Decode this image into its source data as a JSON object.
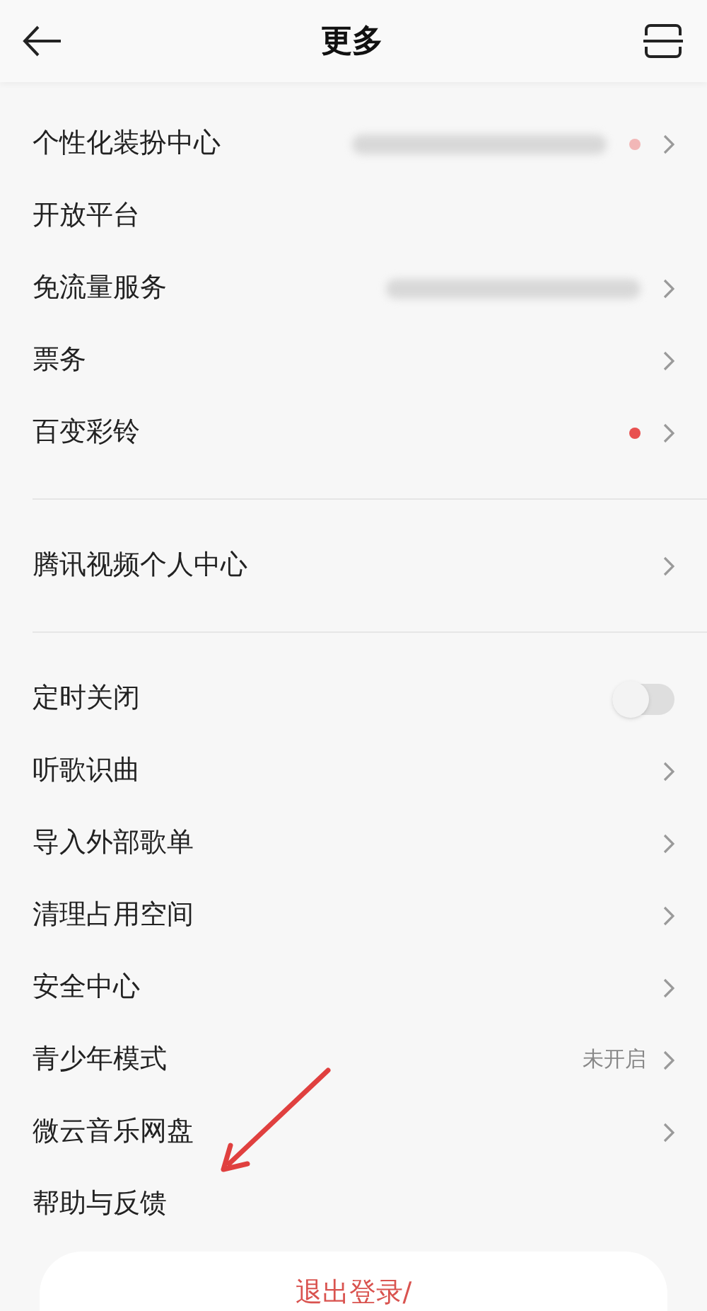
{
  "header": {
    "title": "更多"
  },
  "groups": [
    [
      {
        "label": "个性化装扮中心",
        "kind": "chevron",
        "blurred": true,
        "dot": true
      },
      {
        "label": "开放平台",
        "kind": "plain"
      },
      {
        "label": "免流量服务",
        "kind": "chevron",
        "blurred": true
      },
      {
        "label": "票务",
        "kind": "chevron"
      },
      {
        "label": "百变彩铃",
        "kind": "chevron",
        "dot": true
      }
    ],
    [
      {
        "label": "腾讯视频个人中心",
        "kind": "chevron"
      }
    ],
    [
      {
        "label": "定时关闭",
        "kind": "toggle",
        "on": false
      },
      {
        "label": "听歌识曲",
        "kind": "chevron"
      },
      {
        "label": "导入外部歌单",
        "kind": "chevron"
      },
      {
        "label": "清理占用空间",
        "kind": "chevron"
      },
      {
        "label": "安全中心",
        "kind": "chevron"
      },
      {
        "label": "青少年模式",
        "kind": "chevron",
        "value": "未开启"
      },
      {
        "label": "微云音乐网盘",
        "kind": "chevron"
      },
      {
        "label": "帮助与反馈",
        "kind": "plain"
      }
    ]
  ],
  "logout_button": {
    "label": "退出登录/"
  }
}
